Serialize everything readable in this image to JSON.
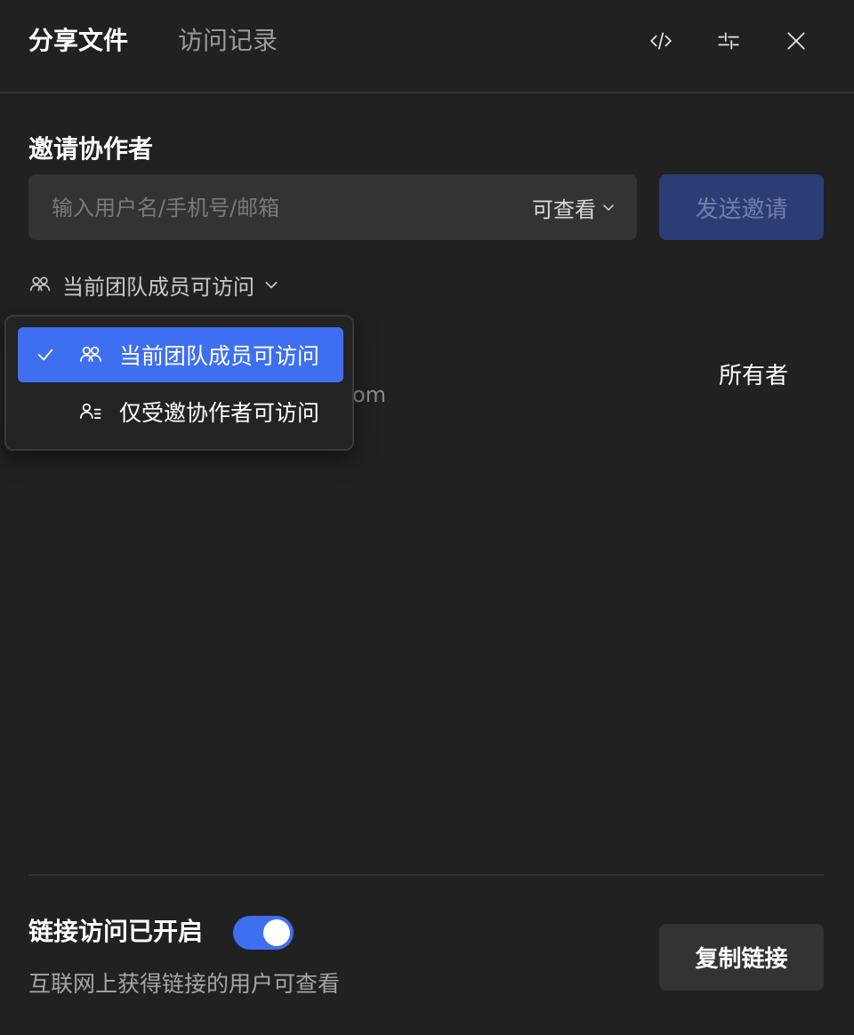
{
  "header": {
    "tabs": [
      {
        "label": "分享文件",
        "active": true
      },
      {
        "label": "访问记录",
        "active": false
      }
    ],
    "icons": [
      "embed-code-icon",
      "settings-sliders-icon",
      "close-icon"
    ]
  },
  "invite": {
    "title": "邀请协作者",
    "input_placeholder": "输入用户名/手机号/邮箱",
    "input_value": "",
    "permission_selected": "可查看",
    "send_button": "发送邀请"
  },
  "access_scope": {
    "selected_label": "当前团队成员可访问",
    "options": [
      {
        "label": "当前团队成员可访问",
        "selected": true,
        "icon": "team-icon"
      },
      {
        "label": "仅受邀协作者可访问",
        "selected": false,
        "icon": "user-list-icon"
      }
    ]
  },
  "members": [
    {
      "email_visible_tail": "om",
      "role": "所有者"
    }
  ],
  "link_sharing": {
    "status_label": "链接访问已开启",
    "enabled": true,
    "description": "互联网上获得链接的用户可查看",
    "copy_button": "复制链接"
  },
  "colors": {
    "background": "#212121",
    "accent": "#3d6ff0",
    "disabled_button": "#2a3d74",
    "input_bg": "#333333"
  }
}
